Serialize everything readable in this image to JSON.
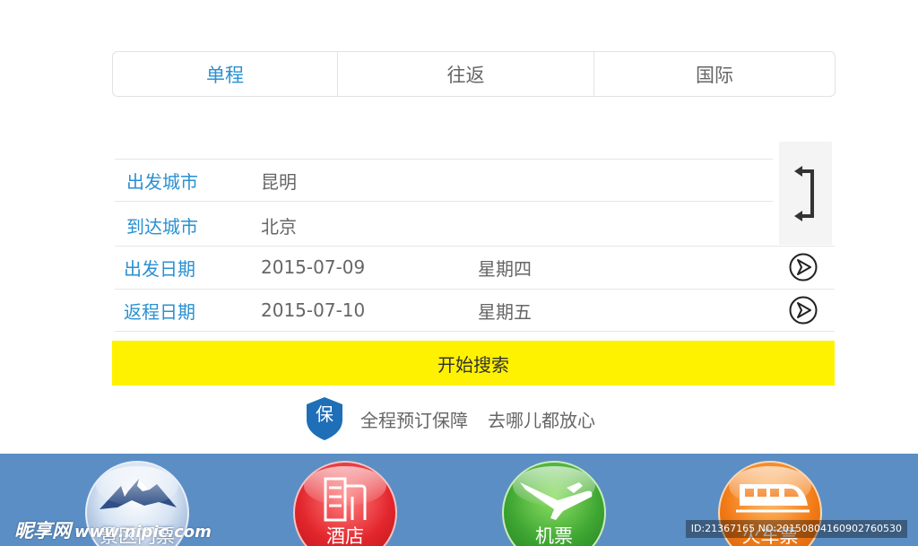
{
  "tabs": [
    {
      "label": "单程",
      "active": true
    },
    {
      "label": "往返",
      "active": false
    },
    {
      "label": "国际",
      "active": false
    }
  ],
  "form": {
    "from": {
      "label": "出发城市",
      "value": "昆明"
    },
    "to": {
      "label": "到达城市",
      "value": "北京"
    },
    "depart": {
      "label": "出发日期",
      "date": "2015-07-09",
      "weekday": "星期四"
    },
    "return": {
      "label": "返程日期",
      "date": "2015-07-10",
      "weekday": "星期五"
    }
  },
  "search": {
    "label": "开始搜索"
  },
  "guarantee": {
    "badge": "保",
    "text1": "全程预订保障",
    "text2": "去哪儿都放心"
  },
  "bottom_nav": [
    {
      "label": "景区门票",
      "icon": "mountain-icon"
    },
    {
      "label": "酒店",
      "icon": "hotel-building-icon"
    },
    {
      "label": "机票",
      "icon": "airplane-icon"
    },
    {
      "label": "火车票",
      "icon": "train-icon"
    }
  ],
  "watermark": {
    "logo": "昵享网",
    "site": "www.nipic.com",
    "id": "ID:21367165 NO:20150804160902760530"
  },
  "colors": {
    "accent": "#2a90d2",
    "search_bg": "#fff200",
    "bottom_bar": "#5b8ec4"
  }
}
